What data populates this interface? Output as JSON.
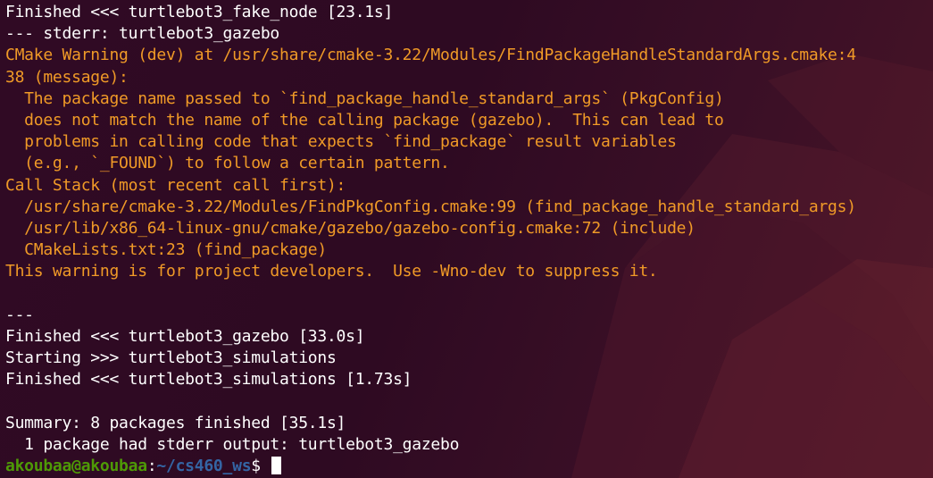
{
  "colors": {
    "background": "#300a24",
    "text": "#ffffff",
    "warning": "#f09a27",
    "prompt_user": "#4e9a06",
    "prompt_path": "#3465a4"
  },
  "lines": [
    {
      "text": "Finished <<< turtlebot3_fake_node [23.1s]",
      "style": "normal"
    },
    {
      "text": "--- stderr: turtlebot3_gazebo",
      "style": "normal"
    },
    {
      "text": "CMake Warning (dev) at /usr/share/cmake-3.22/Modules/FindPackageHandleStandardArgs.cmake:4",
      "style": "warn"
    },
    {
      "text": "38 (message):",
      "style": "warn"
    },
    {
      "text": "  The package name passed to `find_package_handle_standard_args` (PkgConfig)",
      "style": "warn"
    },
    {
      "text": "  does not match the name of the calling package (gazebo).  This can lead to",
      "style": "warn"
    },
    {
      "text": "  problems in calling code that expects `find_package` result variables",
      "style": "warn"
    },
    {
      "text": "  (e.g., `_FOUND`) to follow a certain pattern.",
      "style": "warn"
    },
    {
      "text": "Call Stack (most recent call first):",
      "style": "warn"
    },
    {
      "text": "  /usr/share/cmake-3.22/Modules/FindPkgConfig.cmake:99 (find_package_handle_standard_args)",
      "style": "warn"
    },
    {
      "text": "  /usr/lib/x86_64-linux-gnu/cmake/gazebo/gazebo-config.cmake:72 (include)",
      "style": "warn"
    },
    {
      "text": "  CMakeLists.txt:23 (find_package)",
      "style": "warn"
    },
    {
      "text": "This warning is for project developers.  Use -Wno-dev to suppress it.",
      "style": "warn"
    },
    {
      "text": "",
      "style": "normal"
    },
    {
      "text": "---",
      "style": "normal"
    },
    {
      "text": "Finished <<< turtlebot3_gazebo [33.0s]",
      "style": "normal"
    },
    {
      "text": "Starting >>> turtlebot3_simulations",
      "style": "normal"
    },
    {
      "text": "Finished <<< turtlebot3_simulations [1.73s]",
      "style": "normal"
    },
    {
      "text": "",
      "style": "normal"
    },
    {
      "text": "Summary: 8 packages finished [35.1s]",
      "style": "normal"
    },
    {
      "text": "  1 package had stderr output: turtlebot3_gazebo",
      "style": "normal"
    }
  ],
  "prompt": {
    "user_host": "akoubaa@akoubaa",
    "separator": ":",
    "path": "~/cs460_ws",
    "symbol": "$"
  }
}
